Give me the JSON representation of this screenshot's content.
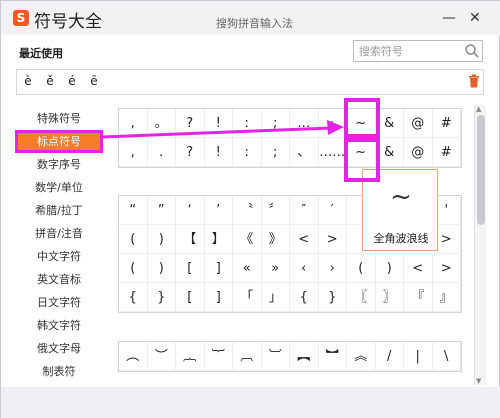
{
  "titlebar": {
    "app_name": "符号大全",
    "ime_name": "搜狗拼音输入法",
    "minimize": "—",
    "close": "✕"
  },
  "recent": {
    "label": "最近使用",
    "symbols": [
      "è",
      "ě",
      "é",
      "ē"
    ]
  },
  "search": {
    "placeholder": "搜索符号"
  },
  "sidebar": {
    "items": [
      {
        "label": "特殊符号"
      },
      {
        "label": "标点符号"
      },
      {
        "label": "数字序号"
      },
      {
        "label": "数学/单位"
      },
      {
        "label": "希腊/拉丁"
      },
      {
        "label": "拼音/注音"
      },
      {
        "label": "中文字符"
      },
      {
        "label": "英文音标"
      },
      {
        "label": "日文字符"
      },
      {
        "label": "韩文字符"
      },
      {
        "label": "俄文字母"
      },
      {
        "label": "制表符"
      }
    ],
    "active_index": 1
  },
  "group1": [
    [
      ",",
      "。",
      "?",
      "!",
      ":",
      ";",
      "…",
      "·",
      "~",
      "&",
      "@",
      "#"
    ],
    [
      ",",
      ".",
      "?",
      "!",
      ":",
      ";",
      "、",
      "……",
      "~",
      "&",
      "@",
      "#"
    ]
  ],
  "group2": [
    [
      "“",
      "”",
      "‘",
      "’",
      "〝",
      "〞",
      "″",
      "′",
      "",
      "",
      "",
      "'"
    ],
    [
      "(",
      ")",
      "【",
      "】",
      "《",
      "》",
      "<",
      ">",
      "",
      "",
      "",
      ">"
    ],
    [
      "(",
      ")",
      "[",
      "]",
      "«",
      "»",
      "‹",
      "›",
      "(",
      ")",
      "<",
      ">"
    ],
    [
      "{",
      "}",
      "[",
      "]",
      "「",
      "」",
      "{",
      "}",
      "〖",
      "〗",
      "『",
      "』"
    ]
  ],
  "group3": [
    [
      "︵",
      "︶",
      "︷",
      "︸",
      "︹",
      "︺",
      "︻",
      "︼",
      "︽",
      "/",
      "|",
      "\\"
    ]
  ],
  "tooltip": {
    "glyph": "~",
    "label": "全角波浪线"
  },
  "colors": {
    "highlight": "#e424e0",
    "active_tab": "#f47d26",
    "logo": "#f05a28"
  }
}
